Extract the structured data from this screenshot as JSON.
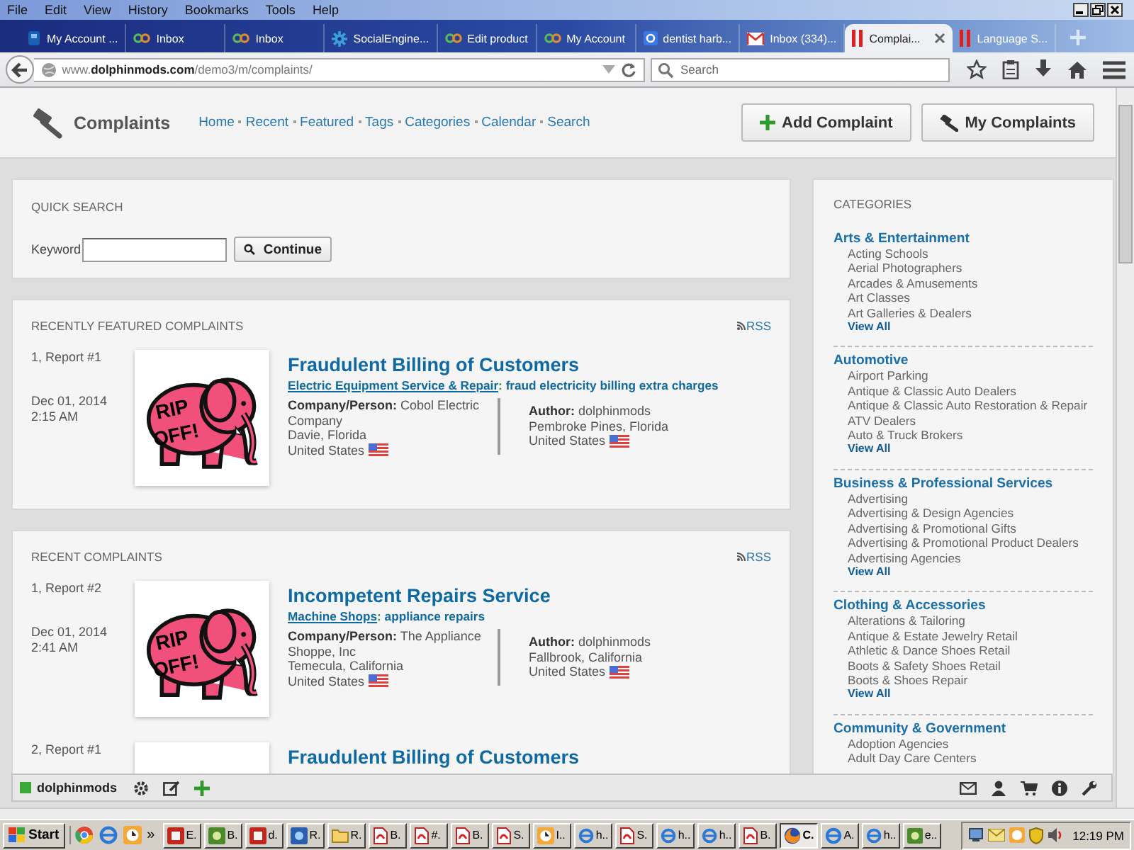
{
  "browser": {
    "menu": [
      "File",
      "Edit",
      "View",
      "History",
      "Bookmarks",
      "Tools",
      "Help"
    ],
    "tabs": [
      {
        "title": "My Account ...",
        "kind": "badge",
        "selected": false
      },
      {
        "title": "Inbox",
        "kind": "loop",
        "selected": false
      },
      {
        "title": "Inbox",
        "kind": "loop",
        "selected": false
      },
      {
        "title": "SocialEngine...",
        "kind": "gear",
        "selected": false
      },
      {
        "title": "Edit product",
        "kind": "loop",
        "selected": false
      },
      {
        "title": "My Account",
        "kind": "loop",
        "selected": false
      },
      {
        "title": "dentist harb...",
        "kind": "square",
        "selected": false
      },
      {
        "title": "Inbox (334)...",
        "kind": "envelope",
        "selected": false
      },
      {
        "title": "Complai...",
        "kind": "bars",
        "selected": true
      },
      {
        "title": "Language S...",
        "kind": "bars",
        "selected": false
      }
    ],
    "url": "www.**dolphinmods.com**/demo3/m/complaints/",
    "search_placeholder": "Search"
  },
  "header": {
    "title": "Complaints",
    "nav": [
      "Home",
      "Recent",
      "Featured",
      "Tags",
      "Categories",
      "Calendar",
      "Search"
    ],
    "buttons": [
      {
        "label": "Add Complaint",
        "kind": "add"
      },
      {
        "label": "My Complaints",
        "kind": "mine"
      }
    ]
  },
  "quick_search": {
    "title": "QUICK SEARCH",
    "label": "Keyword",
    "button": "Continue"
  },
  "sections": [
    {
      "title": "RECENTLY FEATURED COMPLAINTS",
      "rss": "RSS",
      "items": [
        {
          "rank": "1, Report #1",
          "date": "Dec 01, 2014",
          "time": "2:15 AM",
          "image_text": [
            "RIP",
            "OFF!"
          ],
          "title": "Fraudulent Billing of Customers",
          "category": "Electric Equipment Service & Repair",
          "separator": ":",
          "subject": "fraud electricity billing extra charges",
          "company_label": "Company/Person:",
          "company": "Cobol Electric Company",
          "company_location": "Davie, Florida",
          "company_country": "United States",
          "author_label": "Author:",
          "author": "dolphinmods",
          "author_location": "Pembroke Pines, Florida",
          "author_country": "United States"
        }
      ]
    },
    {
      "title": "RECENT COMPLAINTS",
      "rss": "RSS",
      "items": [
        {
          "rank": "1, Report #2",
          "date": "Dec 01, 2014",
          "time": "2:41 AM",
          "image_text": [
            "RIP",
            "OFF!"
          ],
          "title": "Incompetent Repairs Service",
          "category": "Machine Shops",
          "separator": ":",
          "subject": "appliance repairs",
          "company_label": "Company/Person:",
          "company": "The Appliance Shoppe, Inc",
          "company_location": "Temecula, California",
          "company_country": "United States",
          "author_label": "Author:",
          "author": "dolphinmods",
          "author_location": "Fallbrook, California",
          "author_country": "United States"
        },
        {
          "rank": "2, Report #1",
          "title": "Fraudulent Billing of Customers"
        }
      ]
    }
  ],
  "categories": {
    "title": "CATEGORIES",
    "groups": [
      {
        "title": "Arts & Entertainment",
        "items": [
          "Acting Schools",
          "Aerial Photographers",
          "Arcades & Amusements",
          "Art Classes",
          "Art Galleries & Dealers"
        ],
        "view_all": "View All"
      },
      {
        "title": "Automotive",
        "items": [
          "Airport Parking",
          "Antique & Classic Auto Dealers",
          "Antique & Classic Auto Restoration & Repair",
          "ATV Dealers",
          "Auto & Truck Brokers"
        ],
        "view_all": "View All"
      },
      {
        "title": "Business & Professional Services",
        "items": [
          "Advertising",
          "Advertising & Design Agencies",
          "Advertising & Promotional Gifts",
          "Advertising & Promotional Product Dealers",
          "Advertising Agencies"
        ],
        "view_all": "View All"
      },
      {
        "title": "Clothing & Accessories",
        "items": [
          "Alterations & Tailoring",
          "Antique & Estate Jewelry Retail",
          "Athletic & Dance Shoes Retail",
          "Boots & Safety Shoes Retail",
          "Boots & Shoes Repair"
        ],
        "view_all": "View All"
      },
      {
        "title": "Community & Government",
        "items": [
          "Adoption Agencies",
          "Adult Day Care Centers"
        ]
      }
    ]
  },
  "toolbar": {
    "user": "dolphinmods"
  },
  "taskbar": {
    "start": "Start",
    "more": "»",
    "clock": "12:19 PM",
    "buttons": [
      {
        "label": "E.",
        "kind": "red",
        "selected": false
      },
      {
        "label": "B.",
        "kind": "green",
        "selected": false
      },
      {
        "label": "d.",
        "kind": "red",
        "selected": false
      },
      {
        "label": "R.",
        "kind": "blue",
        "selected": false
      },
      {
        "label": "R.",
        "kind": "folder",
        "selected": false
      },
      {
        "label": "B.",
        "kind": "pdf",
        "selected": false
      },
      {
        "label": "#.",
        "kind": "pdf",
        "selected": false
      },
      {
        "label": "B.",
        "kind": "pdf",
        "selected": false
      },
      {
        "label": "S.",
        "kind": "pdf",
        "selected": false
      },
      {
        "label": "I..",
        "kind": "clock",
        "selected": false
      },
      {
        "label": "h..",
        "kind": "globe",
        "selected": false
      },
      {
        "label": "S.",
        "kind": "pdf",
        "selected": false
      },
      {
        "label": "h..",
        "kind": "globe",
        "selected": false
      },
      {
        "label": "h..",
        "kind": "globe",
        "selected": false
      },
      {
        "label": "B.",
        "kind": "pdf",
        "selected": false
      },
      {
        "label": "C.",
        "kind": "fox",
        "selected": true
      },
      {
        "label": "A.",
        "kind": "globe",
        "selected": false
      },
      {
        "label": "h..",
        "kind": "globe",
        "selected": false
      },
      {
        "label": "e..",
        "kind": "green",
        "selected": false
      }
    ]
  }
}
